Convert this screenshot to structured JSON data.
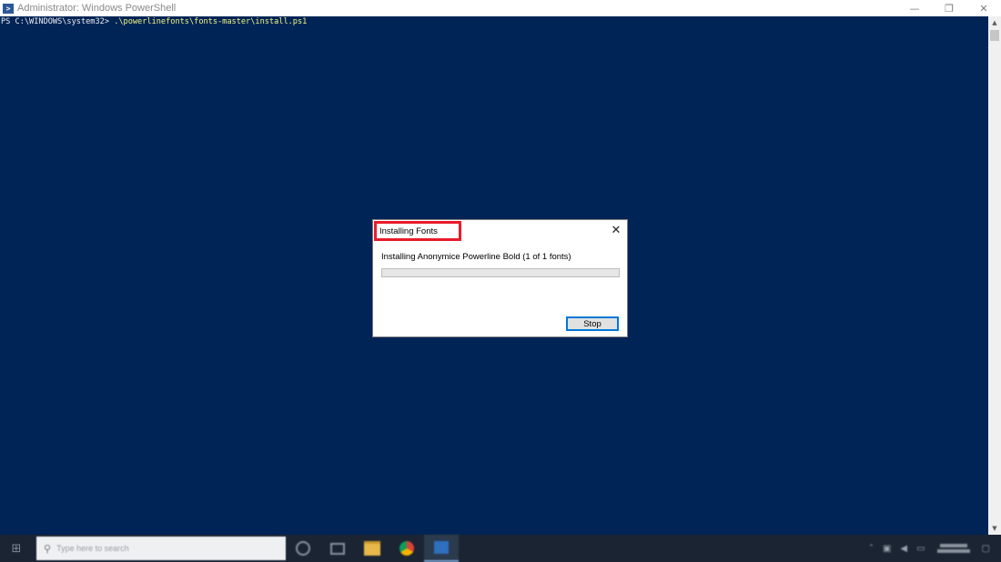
{
  "window": {
    "title": "Administrator: Windows PowerShell",
    "icon": "powershell-icon",
    "controls": {
      "minimize": "—",
      "restore": "❐",
      "close": "✕"
    }
  },
  "console": {
    "prompt": "PS C:\\WINDOWS\\system32> ",
    "command": ".\\powerlinefonts\\fonts-master\\install.ps1"
  },
  "dialog": {
    "title": "Installing Fonts",
    "close_glyph": "✕",
    "message": "Installing Anonymice Powerline Bold (1 of 1 fonts)",
    "progress": 0,
    "stop_label": "Stop"
  },
  "taskbar": {
    "start_glyph": "⊞",
    "search_glyph": "⚲",
    "search_placeholder": "Type here to search",
    "icons": [
      "cortana-icon",
      "task-view-icon",
      "file-explorer-icon",
      "chrome-icon",
      "powershell-icon"
    ]
  },
  "colors": {
    "console_bg": "#012456",
    "prompt_text": "#eeedf0",
    "command_text": "#f5f582",
    "highlight_box": "#e81c2a",
    "focus_border": "#0078d7"
  }
}
